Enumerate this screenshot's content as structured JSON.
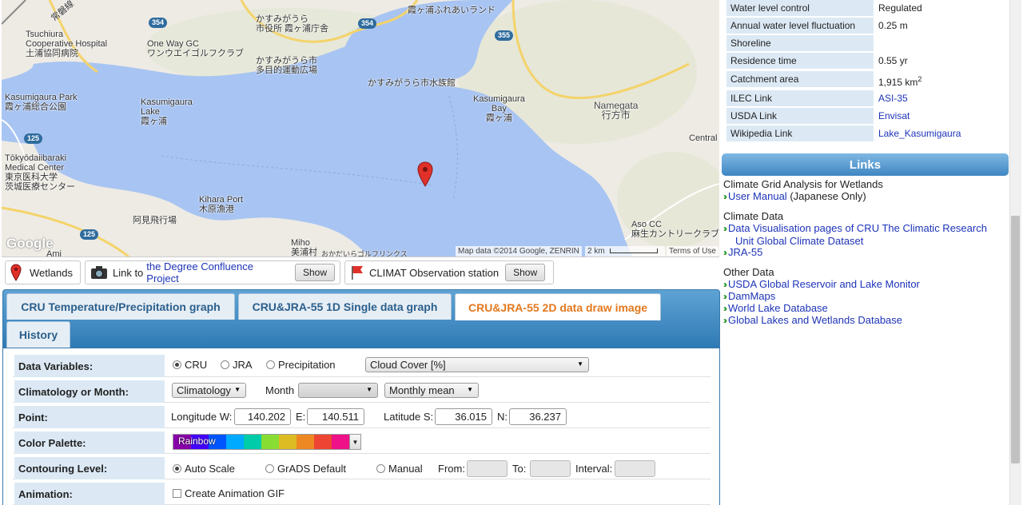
{
  "map": {
    "labels": {
      "tsuchiura_hospital": "Tsuchiura\nCooperative Hospital\n土浦協同病院",
      "one_way_gc": "One Way GC\nワンウエイゴルフクラブ",
      "kasumigaura_city": "かすみがうら\n市役所 霞ヶ浦庁舎",
      "kasumigaura_plaza": "かすみがうら市\n多目的運動広場",
      "fureai_land": "霞ヶ浦ふれあいランド",
      "kasumigaura_park": "Kasumigaura Park\n霞ヶ浦総合公園",
      "kasumigaura_lake": "Kasumigaura\nLake\n霞ヶ浦",
      "aquarium": "かすみがうら市水族館",
      "kasumigaura_bay": "Kasumigaura\nBay\n霞ヶ浦",
      "namegata": "Namegata\n行方市",
      "tokyo_ibaraki": "Tōkyōdaiibaraki\nMedical Center\n東京医科大学\n茨城医療センター",
      "central": "Central",
      "kihara_port": "Kihara Port\n木原漁港",
      "ami_airfield": "阿見飛行場",
      "miho": "Miho\n美浦村",
      "miho_golf": "おかだいらゴルフリンクス",
      "aso_cc": "Aso CC\n麻生カントリークラブ",
      "ami": "Ami",
      "joban_line": "常磐線",
      "google": "Google"
    },
    "roads": {
      "r354a": "354",
      "r354b": "354",
      "r355": "355",
      "r125a": "125",
      "r125b": "125"
    },
    "attribution": "Map data ©2014 Google, ZENRIN",
    "scale": "2 km",
    "terms": "Terms of Use"
  },
  "controls": {
    "wetlands": "Wetlands",
    "link_to": "Link to",
    "degree_link": "the Degree Confluence Project",
    "show1": "Show",
    "climat": "CLIMAT Observation station",
    "show2": "Show"
  },
  "tabs": {
    "t1": "CRU Temperature/Precipitation graph",
    "t2": "CRU&JRA-55 1D Single data graph",
    "t3": "CRU&JRA-55 2D data draw image",
    "t4": "History"
  },
  "form": {
    "data_variables": "Data Variables:",
    "cru": "CRU",
    "jra": "JRA",
    "precipitation": "Precipitation",
    "variable_select": "Cloud Cover [%]",
    "climatology_month": "Climatology or Month:",
    "climatology_select": "Climatology",
    "month": "Month",
    "month_select": "",
    "monthly_mean_select": "Monthly mean",
    "point": "Point:",
    "lon_w_label": "Longitude W:",
    "lon_w": "140.202",
    "e_label": "E:",
    "lon_e": "140.511",
    "lat_s_label": "Latitude S:",
    "lat_s": "36.015",
    "n_label": "N:",
    "lat_n": "36.237",
    "color_palette": "Color Palette:",
    "palette_name": "Rainbow",
    "contouring": "Contouring Level:",
    "auto_scale": "Auto Scale",
    "grads_default": "GrADS Default",
    "manual": "Manual",
    "from": "From:",
    "to": "To:",
    "interval": "Interval:",
    "animation": "Animation:",
    "create_gif": "Create Animation GIF"
  },
  "info": {
    "water_level_control_k": "Water level control",
    "water_level_control_v": "Regulated",
    "fluctuation_k": "Annual water level fluctuation",
    "fluctuation_v": "0.25 m",
    "shoreline_k": "Shoreline",
    "shoreline_v": "",
    "residence_k": "Residence time",
    "residence_v": "0.55 yr",
    "catchment_k": "Catchment area",
    "catchment_v": "1,915 km",
    "catchment_sup": "2",
    "ilec_k": "ILEC Link",
    "ilec_v": "ASI-35",
    "usda_k": "USDA Link",
    "usda_v": "Envisat",
    "wiki_k": "Wikipedia Link",
    "wiki_v": "Lake_Kasumigaura"
  },
  "links": {
    "header": "Links",
    "cgaw_title": "Climate Grid Analysis for Wetlands",
    "user_manual": "User Manual",
    "user_manual_note": "(Japanese Only)",
    "climate_data_title": "Climate Data",
    "cru_link": "Data Visualisation pages of CRU The Climatic Research Unit Global Climate Dataset",
    "jra_link": "JRA-55",
    "other_title": "Other Data",
    "usda_monitor": "USDA Global Reservoir and Lake Monitor",
    "dammaps": "DamMaps",
    "world_lake": "World Lake Database",
    "glwd": "Global Lakes and Wetlands Database"
  },
  "colors": {
    "tab_bar": "#3f86c2",
    "active_tab_text": "#e2781e",
    "link": "#1d33b8",
    "label_bg": "#dce9f5",
    "lake": "#a8c4f2",
    "land": "#eeebe4",
    "palette": [
      "#8800aa",
      "#4400ff",
      "#0055ff",
      "#00aaff",
      "#00ccaa",
      "#88dd33",
      "#ddbb22",
      "#ee8822",
      "#ee4433",
      "#ee1188"
    ]
  }
}
